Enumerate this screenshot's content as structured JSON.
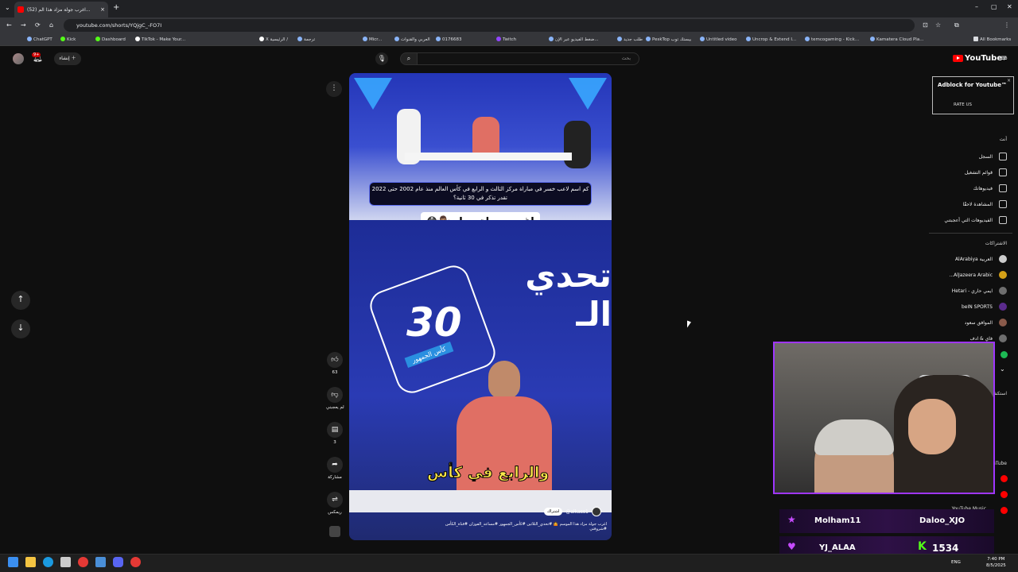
{
  "browser": {
    "tab_title": "(52) اغرب جولة مزاد هذا الم...",
    "new_tab": "+",
    "url": "youtube.com/shorts/YQjgC_-FO7I",
    "bookmarks": [
      "ChatGPT",
      "Kick",
      "Dashboard",
      "TikTok - Make Your...",
      "X الرئيسية /",
      "ترجمة",
      "Micr...",
      "العربي والقنوات",
      "0176683",
      "Twitch",
      "ضغط الفيديو عبر الإن...",
      "طلب جديد",
      "PeskTop بيستك توب",
      "Untitled video",
      "Uncrop & Extend I...",
      "temcogaming - Kick...",
      "Kamatera Cloud Pla..."
    ],
    "all_bookmarks": "All Bookmarks"
  },
  "youtube": {
    "logo_text": "YouTube",
    "logo_sup": "JO",
    "search_placeholder": "بحث",
    "create_label": "إنشاء",
    "notif_count": "9+"
  },
  "video": {
    "question_banner": "كم اسم لاعب خسر في مباراة مركز الثالث و الرابع في كأس العالم منذ عام 2002 حتى 2022 تقدر تذكر في 30 ثانية؟",
    "caption": "اغرب جولة مزاد 🤷🏽‍♂️😳",
    "logo_number": "30",
    "logo_ribbon": "كأس الجمهور",
    "show_title": "تحدي الـ",
    "sub_caption": "والرابع في كأس",
    "channel": "@alkass1",
    "subscribe": "اشتراك",
    "description": "اغرب جولة مزاد هذا الموسم 🤷 #تحدي_الثلاثين #كأس_الجمهور #مساعد_الفوزان #قناة_الكأس #شروقتي"
  },
  "actions": {
    "like_count": "63",
    "dislike_label": "لم يعجبني",
    "comment_count": "3",
    "share_label": "مشاركة",
    "remix_label": "ريمكس"
  },
  "adblock": {
    "title": "Adblock for Youtube™",
    "rate": "RATE US",
    "close": "×"
  },
  "sidebar": {
    "you_header": "أنت",
    "you_items": [
      "السجل",
      "قوائم التشغيل",
      "فيديوهاتك",
      "المشاهدة لاحقًا",
      "الفيديوهات التي أعجبتني"
    ],
    "subs_header": "الاشتراكات",
    "subs": [
      "العربية AlArabiya",
      "AlJazeera Arabic...",
      "ايمي حاري - Hetari",
      "beIN SPORTS",
      "الموافق سعود",
      "فاي & ادف"
    ],
    "explore_header": "استكشاف",
    "more_header": "المزيد من YouTube",
    "more_items": [
      "YouTube Music"
    ]
  },
  "stream_overlay": {
    "donor_left_1": "Molham11",
    "donor_right_1": "Daloo_XJO",
    "donor_left_2": "YJ_ALAA",
    "viewer_count": "1534"
  },
  "taskbar": {
    "lang": "ENG",
    "time": "7:40 PM",
    "date": "8/5/2025"
  },
  "colors": {
    "yt_red": "#ff0000",
    "accent_purple": "#9f36ff",
    "kick_green": "#53fc18"
  }
}
